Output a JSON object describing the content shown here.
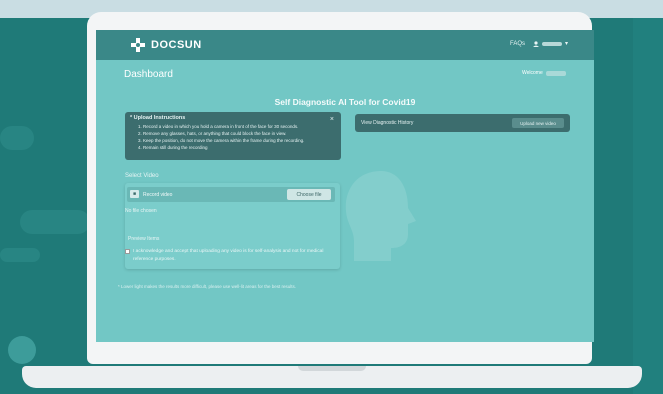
{
  "navbar": {
    "brand": "DOCSUN",
    "faq": "FAQs",
    "user_caret": "▾"
  },
  "dashboard": {
    "title": "Dashboard",
    "welcome": "Welcome"
  },
  "page": {
    "title": "Self Diagnostic AI Tool for Covid19"
  },
  "instructions": {
    "heading": "* Upload Instructions",
    "close": "×",
    "items": [
      "1. Record a video in which you hold a camera in front of the face for 30 seconds.",
      "2. Remove any glasses, hats, or anything that could block the face in view.",
      "3. Keep the position, do not move the camera within the frame during the recording.",
      "4. Remain still during the recording"
    ]
  },
  "library": {
    "label": "View Diagnostic History",
    "button": "Upload new video"
  },
  "upload": {
    "select_label": "Select Video",
    "record_label": "Record video",
    "choose_button": "Choose file",
    "no_file": "No file chosen",
    "preview_label": "Preview Items",
    "consent": "I acknowledge and accept that uploading any video is for self-analysis and not for medical reference purposes."
  },
  "footnote": "* Lower light makes the results more difficult, please use well-lit areas for the best results."
}
